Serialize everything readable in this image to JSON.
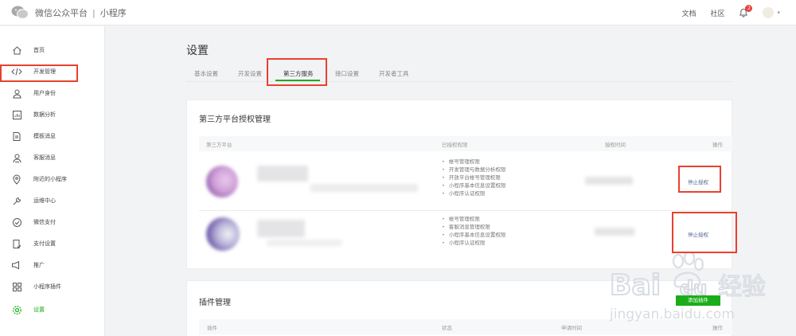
{
  "header": {
    "brand": "微信公众平台",
    "separator": "|",
    "product": "小程序",
    "links": [
      "文档",
      "社区"
    ],
    "notification_count": "2"
  },
  "sidebar": {
    "items": [
      {
        "label": "首页",
        "icon": "home-icon"
      },
      {
        "label": "开发管理",
        "icon": "code-icon"
      },
      {
        "label": "用户身份",
        "icon": "user-icon"
      },
      {
        "label": "数据分析",
        "icon": "chart-icon"
      },
      {
        "label": "模板消息",
        "icon": "document-icon"
      },
      {
        "label": "客服消息",
        "icon": "customer-service-icon"
      },
      {
        "label": "附近的小程序",
        "icon": "location-icon"
      },
      {
        "label": "运维中心",
        "icon": "wrench-icon"
      },
      {
        "label": "微信支付",
        "icon": "pay-icon"
      },
      {
        "label": "支付设置",
        "icon": "payment-settings-icon"
      },
      {
        "label": "推广",
        "icon": "megaphone-icon"
      },
      {
        "label": "小程序插件",
        "icon": "plugin-icon"
      },
      {
        "label": "设置",
        "icon": "gear-icon"
      }
    ]
  },
  "main": {
    "title": "设置",
    "tabs": [
      {
        "label": "基本设置"
      },
      {
        "label": "开发设置"
      },
      {
        "label": "第三方服务"
      },
      {
        "label": "接口设置"
      },
      {
        "label": "开发者工具"
      }
    ],
    "third_party": {
      "title": "第三方平台授权管理",
      "columns": [
        "第三方平台",
        "已授权权限",
        "授权时间",
        "操作"
      ],
      "rows": [
        {
          "permissions": [
            "帐号管理权限",
            "开发管理与数据分析权限",
            "开放平台帐号管理权限",
            "小程序基本信息设置权限",
            "小程序认证权限"
          ],
          "action": "停止授权"
        },
        {
          "permissions": [
            "帐号管理权限",
            "客服消息管理权限",
            "小程序基本信息设置权限",
            "小程序认证权限"
          ],
          "action": "停止授权"
        }
      ]
    },
    "plugins": {
      "title": "插件管理",
      "add_button": "添加插件",
      "columns": [
        "插件",
        "状态",
        "申请时间",
        "操作"
      ]
    }
  },
  "watermark": {
    "logo_text": "Bai",
    "logo_text_2": "du",
    "cn_text": "经验",
    "url": "jingyan.baidu.com"
  },
  "colors": {
    "accent": "#1aad19",
    "link": "#576b95",
    "highlight_box": "#e8412f"
  }
}
